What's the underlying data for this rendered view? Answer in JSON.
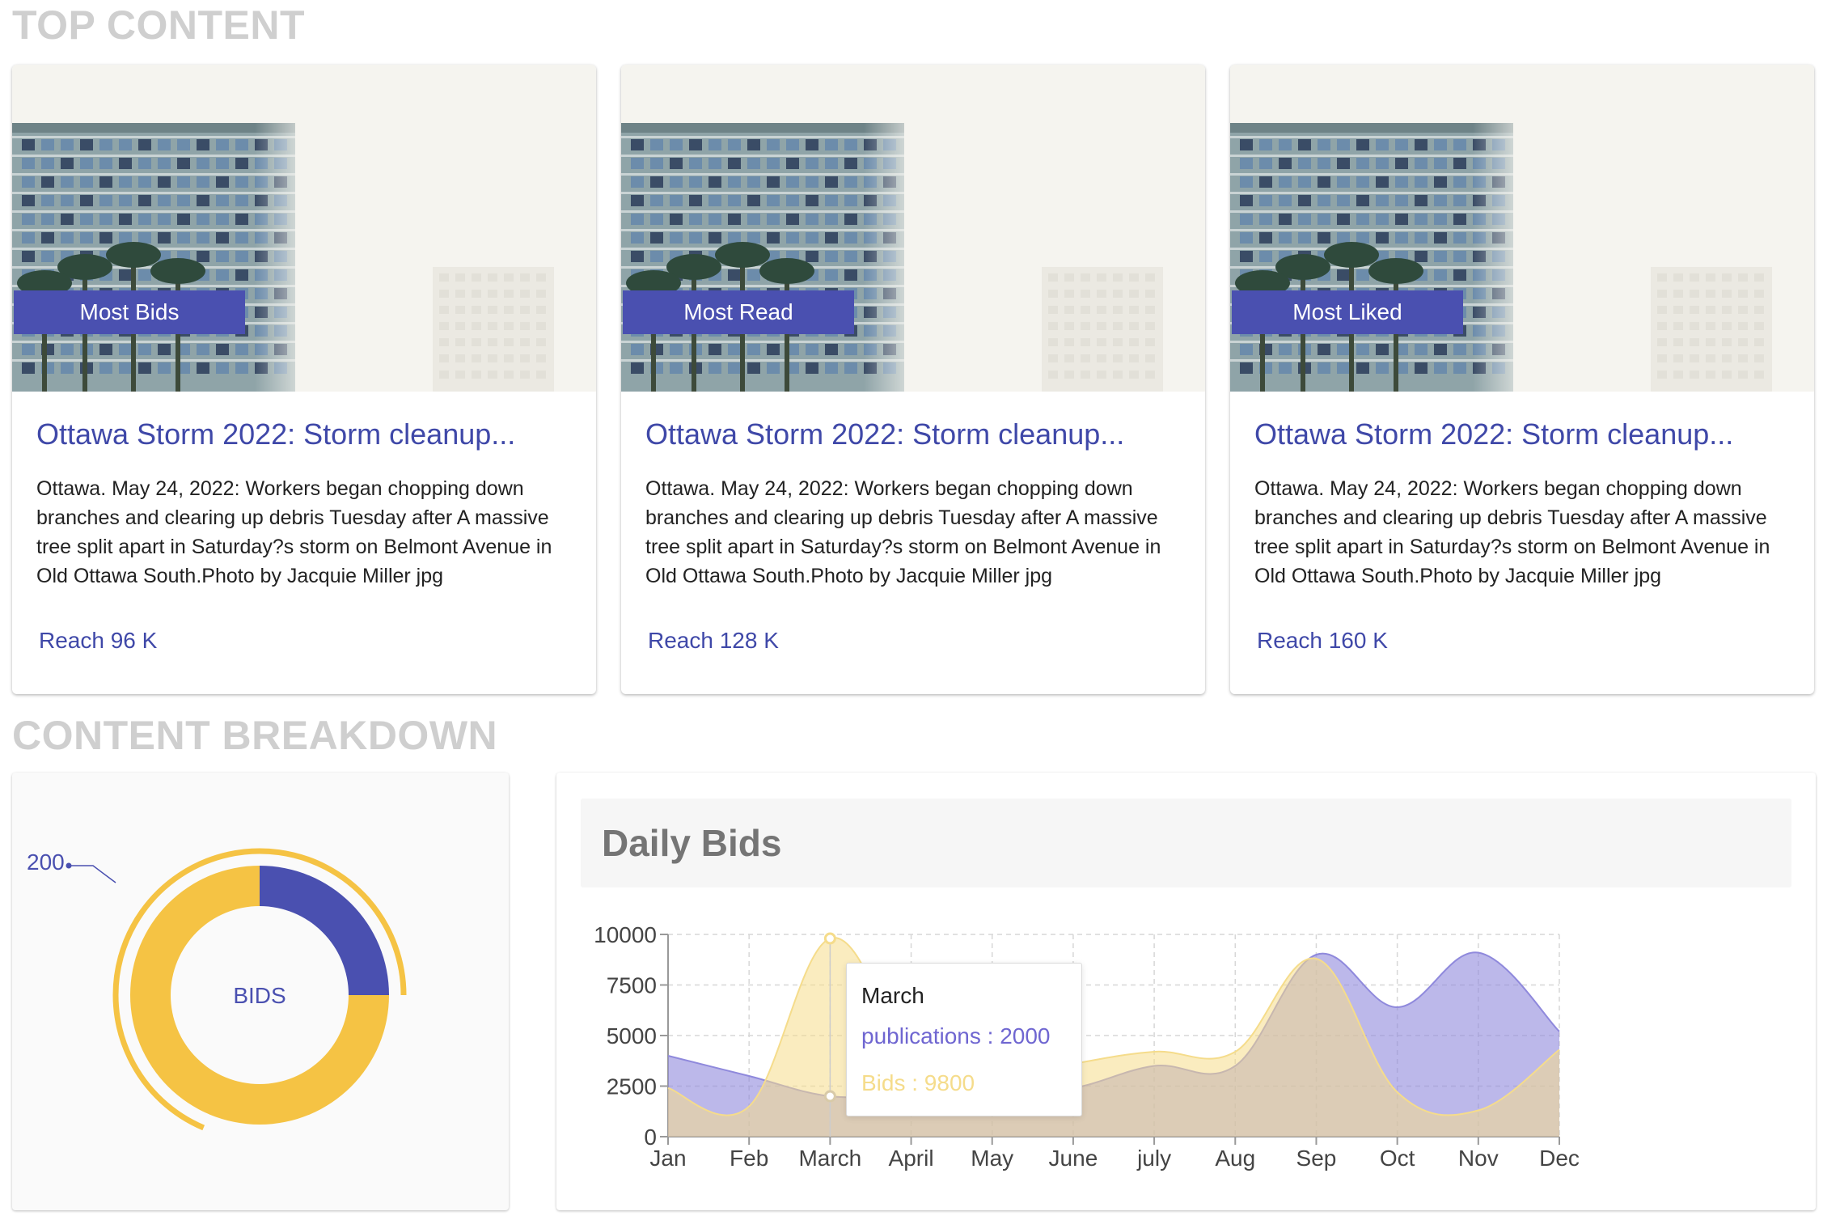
{
  "sections": {
    "top_content": "TOP CONTENT",
    "content_breakdown": "CONTENT BREAKDOWN"
  },
  "cards": [
    {
      "badge": "Most Bids",
      "title": "Ottawa Storm 2022: Storm cleanup...",
      "description": "Ottawa. May 24, 2022: Workers began chopping down branches and clearing up debris Tuesday after A massive tree split apart in Saturday?s storm on Belmont Avenue in Old Ottawa South.Photo by Jacquie Miller jpg",
      "reach": "Reach 96 K"
    },
    {
      "badge": "Most Read",
      "title": "Ottawa Storm 2022: Storm cleanup...",
      "description": "Ottawa. May 24, 2022: Workers began chopping down branches and clearing up debris Tuesday after A massive tree split apart in Saturday?s storm on Belmont Avenue in Old Ottawa South.Photo by Jacquie Miller jpg",
      "reach": "Reach 128 K"
    },
    {
      "badge": "Most Liked",
      "title": "Ottawa Storm 2022: Storm cleanup...",
      "description": "Ottawa. May 24, 2022: Workers began chopping down branches and clearing up debris Tuesday after A massive tree split apart in Saturday?s storm on Belmont Avenue in Old Ottawa South.Photo by Jacquie Miller jpg",
      "reach": "Reach 160 K"
    }
  ],
  "donut": {
    "center_label": "BIDS",
    "callout_value": "200",
    "colors": {
      "primary": "#f5c344",
      "secondary": "#4a50b0"
    },
    "segments": [
      {
        "value": 75,
        "color": "#f5c344"
      },
      {
        "value": 25,
        "color": "#4a50b0"
      }
    ]
  },
  "chart_panel": {
    "title": "Daily Bids"
  },
  "chart_data": {
    "type": "area",
    "title": "Daily Bids",
    "categories": [
      "Jan",
      "Feb",
      "March",
      "April",
      "May",
      "June",
      "july",
      "Aug",
      "Sep",
      "Oct",
      "Nov",
      "Dec"
    ],
    "y_ticks": [
      "0",
      "2500",
      "5000",
      "7500",
      "10000"
    ],
    "ylim": [
      0,
      10000
    ],
    "grid": true,
    "series": [
      {
        "name": "publications",
        "color": "#8f89dc",
        "values": [
          4000,
          3000,
          2000,
          2100,
          2100,
          2400,
          3500,
          3500,
          9000,
          6400,
          9100,
          5200
        ]
      },
      {
        "name": "Bids",
        "color": "#f5dc8b",
        "values": [
          2400,
          1500,
          9800,
          4300,
          2800,
          3600,
          4200,
          4200,
          8800,
          2200,
          1300,
          4300
        ]
      }
    ],
    "tooltip": {
      "title": "March",
      "publications_text": "publications : 2000",
      "bids_text": "Bids : 9800"
    }
  }
}
